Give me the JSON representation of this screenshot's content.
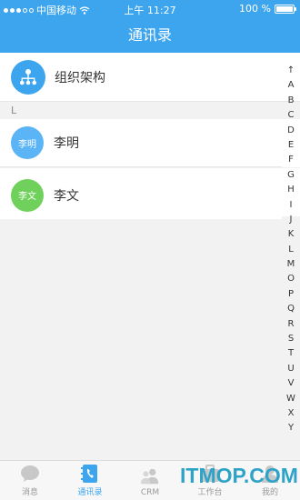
{
  "status_bar": {
    "carrier": "中国移动",
    "time": "上午 11:27",
    "battery": "100 %"
  },
  "nav": {
    "title": "通讯录"
  },
  "org": {
    "label": "组织架构"
  },
  "section": {
    "letter": "L"
  },
  "contacts": [
    {
      "avatar_text": "李明",
      "name": "李明",
      "color": "#5ab4f5"
    },
    {
      "avatar_text": "李文",
      "name": "李文",
      "color": "#6fd15b"
    }
  ],
  "index_bar": [
    "↑",
    "A",
    "B",
    "C",
    "D",
    "E",
    "F",
    "G",
    "H",
    "I",
    "J",
    "K",
    "L",
    "M",
    "O",
    "P",
    "Q",
    "R",
    "S",
    "T",
    "U",
    "V",
    "W",
    "X",
    "Y"
  ],
  "tabs": [
    {
      "label": "消息",
      "icon": "chat-bubble-icon",
      "active": false
    },
    {
      "label": "通讯录",
      "icon": "address-book-icon",
      "active": true
    },
    {
      "label": "CRM",
      "icon": "people-icon",
      "active": false
    },
    {
      "label": "工作台",
      "icon": "briefcase-icon",
      "active": false
    },
    {
      "label": "我的",
      "icon": "person-icon",
      "active": false
    }
  ],
  "watermark": "ITMOP.COM",
  "colors": {
    "accent": "#3da5ee"
  }
}
